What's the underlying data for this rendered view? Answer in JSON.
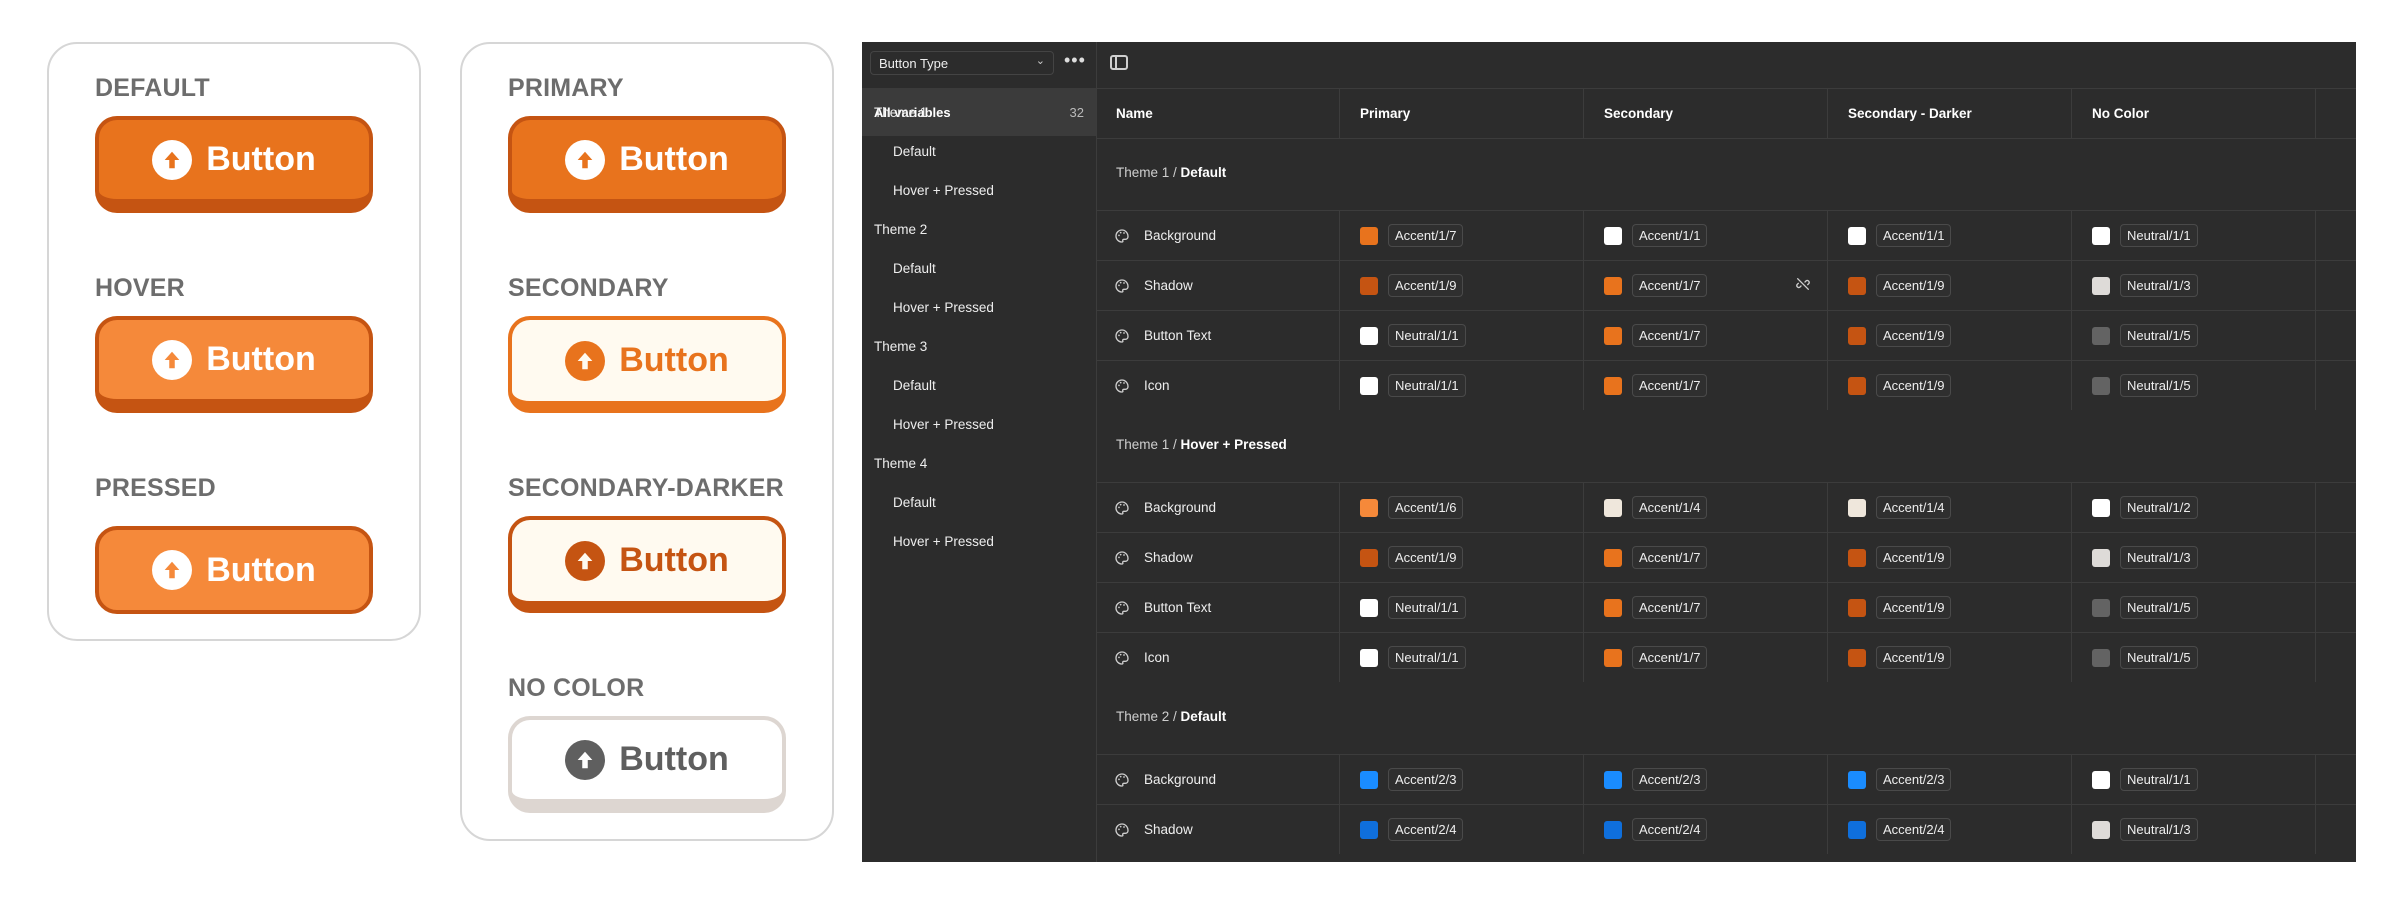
{
  "states_card": {
    "items": [
      {
        "label": "DEFAULT",
        "button": "Button"
      },
      {
        "label": "HOVER",
        "button": "Button"
      },
      {
        "label": "PRESSED",
        "button": "Button"
      }
    ]
  },
  "types_card": {
    "items": [
      {
        "label": "PRIMARY",
        "button": "Button"
      },
      {
        "label": "SECONDARY",
        "button": "Button"
      },
      {
        "label": "SECONDARY-DARKER",
        "button": "Button"
      },
      {
        "label": "NO COLOR",
        "button": "Button"
      }
    ]
  },
  "colors": {
    "accent": "#e8731d",
    "accent_dark": "#c55412",
    "accent_light": "#f5893a",
    "blue": "#1a8cff",
    "blue_dark": "#0f6fdc"
  },
  "panel": {
    "collection": "Button Type",
    "all_variables": {
      "label": "All variables",
      "count": "32"
    },
    "groups": [
      {
        "label": "Theme 1",
        "subs": [
          "Default",
          "Hover + Pressed"
        ]
      },
      {
        "label": "Theme 2",
        "subs": [
          "Default",
          "Hover + Pressed"
        ]
      },
      {
        "label": "Theme 3",
        "subs": [
          "Default",
          "Hover + Pressed"
        ]
      },
      {
        "label": "Theme 4",
        "subs": [
          "Default",
          "Hover + Pressed"
        ]
      }
    ],
    "columns": [
      "Name",
      "Primary",
      "Secondary",
      "Secondary - Darker",
      "No Color"
    ],
    "sections": [
      {
        "prefix": "Theme 1 / ",
        "title": "Default",
        "rows": [
          {
            "name": "Background",
            "cells": [
              {
                "v": "Accent/1/7",
                "c": "#e8731d"
              },
              {
                "v": "Accent/1/1",
                "c": "#ffffff"
              },
              {
                "v": "Accent/1/1",
                "c": "#ffffff"
              },
              {
                "v": "Neutral/1/1",
                "c": "#ffffff"
              }
            ]
          },
          {
            "name": "Shadow",
            "cells": [
              {
                "v": "Accent/1/9",
                "c": "#c55412"
              },
              {
                "v": "Accent/1/7",
                "c": "#e8731d"
              },
              {
                "v": "Accent/1/9",
                "c": "#c55412"
              },
              {
                "v": "Neutral/1/3",
                "c": "#dedbd8"
              }
            ]
          },
          {
            "name": "Button Text",
            "cells": [
              {
                "v": "Neutral/1/1",
                "c": "#ffffff"
              },
              {
                "v": "Accent/1/7",
                "c": "#e8731d"
              },
              {
                "v": "Accent/1/9",
                "c": "#c55412"
              },
              {
                "v": "Neutral/1/5",
                "c": "#636363"
              }
            ]
          },
          {
            "name": "Icon",
            "cells": [
              {
                "v": "Neutral/1/1",
                "c": "#ffffff"
              },
              {
                "v": "Accent/1/7",
                "c": "#e8731d"
              },
              {
                "v": "Accent/1/9",
                "c": "#c55412"
              },
              {
                "v": "Neutral/1/5",
                "c": "#636363"
              }
            ]
          }
        ]
      },
      {
        "prefix": "Theme 1 / ",
        "title": "Hover + Pressed",
        "rows": [
          {
            "name": "Background",
            "cells": [
              {
                "v": "Accent/1/6",
                "c": "#f5893a"
              },
              {
                "v": "Accent/1/4",
                "c": "#efe7dc"
              },
              {
                "v": "Accent/1/4",
                "c": "#efe7dc"
              },
              {
                "v": "Neutral/1/2",
                "c": "#ffffff"
              }
            ]
          },
          {
            "name": "Shadow",
            "cells": [
              {
                "v": "Accent/1/9",
                "c": "#c55412"
              },
              {
                "v": "Accent/1/7",
                "c": "#e8731d"
              },
              {
                "v": "Accent/1/9",
                "c": "#c55412"
              },
              {
                "v": "Neutral/1/3",
                "c": "#dedbd8"
              }
            ]
          },
          {
            "name": "Button Text",
            "cells": [
              {
                "v": "Neutral/1/1",
                "c": "#ffffff"
              },
              {
                "v": "Accent/1/7",
                "c": "#e8731d"
              },
              {
                "v": "Accent/1/9",
                "c": "#c55412"
              },
              {
                "v": "Neutral/1/5",
                "c": "#636363"
              }
            ]
          },
          {
            "name": "Icon",
            "cells": [
              {
                "v": "Neutral/1/1",
                "c": "#ffffff"
              },
              {
                "v": "Accent/1/7",
                "c": "#e8731d"
              },
              {
                "v": "Accent/1/9",
                "c": "#c55412"
              },
              {
                "v": "Neutral/1/5",
                "c": "#636363"
              }
            ]
          }
        ]
      },
      {
        "prefix": "Theme 2 / ",
        "title": "Default",
        "rows": [
          {
            "name": "Background",
            "cells": [
              {
                "v": "Accent/2/3",
                "c": "#1a8cff"
              },
              {
                "v": "Accent/2/3",
                "c": "#1a8cff"
              },
              {
                "v": "Accent/2/3",
                "c": "#1a8cff"
              },
              {
                "v": "Neutral/1/1",
                "c": "#ffffff"
              }
            ]
          },
          {
            "name": "Shadow",
            "cells": [
              {
                "v": "Accent/2/4",
                "c": "#0f6fdc"
              },
              {
                "v": "Accent/2/4",
                "c": "#0f6fdc"
              },
              {
                "v": "Accent/2/4",
                "c": "#0f6fdc"
              },
              {
                "v": "Neutral/1/3",
                "c": "#dedbd8"
              }
            ]
          }
        ]
      }
    ]
  }
}
